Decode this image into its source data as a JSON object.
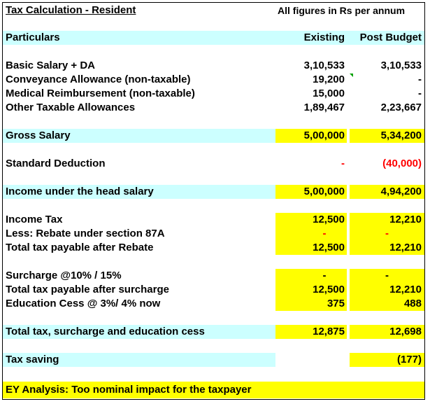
{
  "title": "Tax Calculation - Resident",
  "figures_note": "All figures in Rs per annum",
  "header": {
    "label": "Particulars",
    "col1": "Existing",
    "col2": "Post Budget"
  },
  "rows": {
    "basic": {
      "label": "Basic Salary + DA",
      "existing": "3,10,533",
      "post": "3,10,533"
    },
    "conveyance": {
      "label": "Conveyance Allowance (non-taxable)",
      "existing": "19,200",
      "post": "-"
    },
    "medical": {
      "label": "Medical Reimbursement (non-taxable)",
      "existing": "15,000",
      "post": "-"
    },
    "other": {
      "label": "Other Taxable Allowances",
      "existing": "1,89,467",
      "post": "2,23,667"
    },
    "gross": {
      "label": "Gross Salary",
      "existing": "5,00,000",
      "post": "5,34,200"
    },
    "std": {
      "label": "Standard Deduction",
      "existing": "-",
      "post": "(40,000)"
    },
    "income_salary": {
      "label": "Income under the head salary",
      "existing": "5,00,000",
      "post": "4,94,200"
    },
    "income_tax": {
      "label": "Income Tax",
      "existing": "12,500",
      "post": "12,210"
    },
    "rebate": {
      "label": "Less: Rebate under section 87A",
      "existing": "-",
      "post": "-"
    },
    "after_rebate": {
      "label": "Total tax payable after Rebate",
      "existing": "12,500",
      "post": "12,210"
    },
    "surcharge": {
      "label": "Surcharge @10% / 15%",
      "existing": "-",
      "post": "-"
    },
    "after_surcharge": {
      "label": "Total tax payable after surcharge",
      "existing": "12,500",
      "post": "12,210"
    },
    "cess": {
      "label": "Education Cess @ 3%/ 4% now",
      "existing": "375",
      "post": "488"
    },
    "total": {
      "label": "Total tax, surcharge and education cess",
      "existing": "12,875",
      "post": "12,698"
    },
    "saving": {
      "label": "Tax saving",
      "post": "(177)"
    }
  },
  "analysis": "EY Analysis: Too nominal impact for the taxpayer",
  "colors": {
    "cyan": "#ccffff",
    "yellow": "#ffff00",
    "negative": "#ff0000",
    "comment_marker": "#00a000"
  }
}
